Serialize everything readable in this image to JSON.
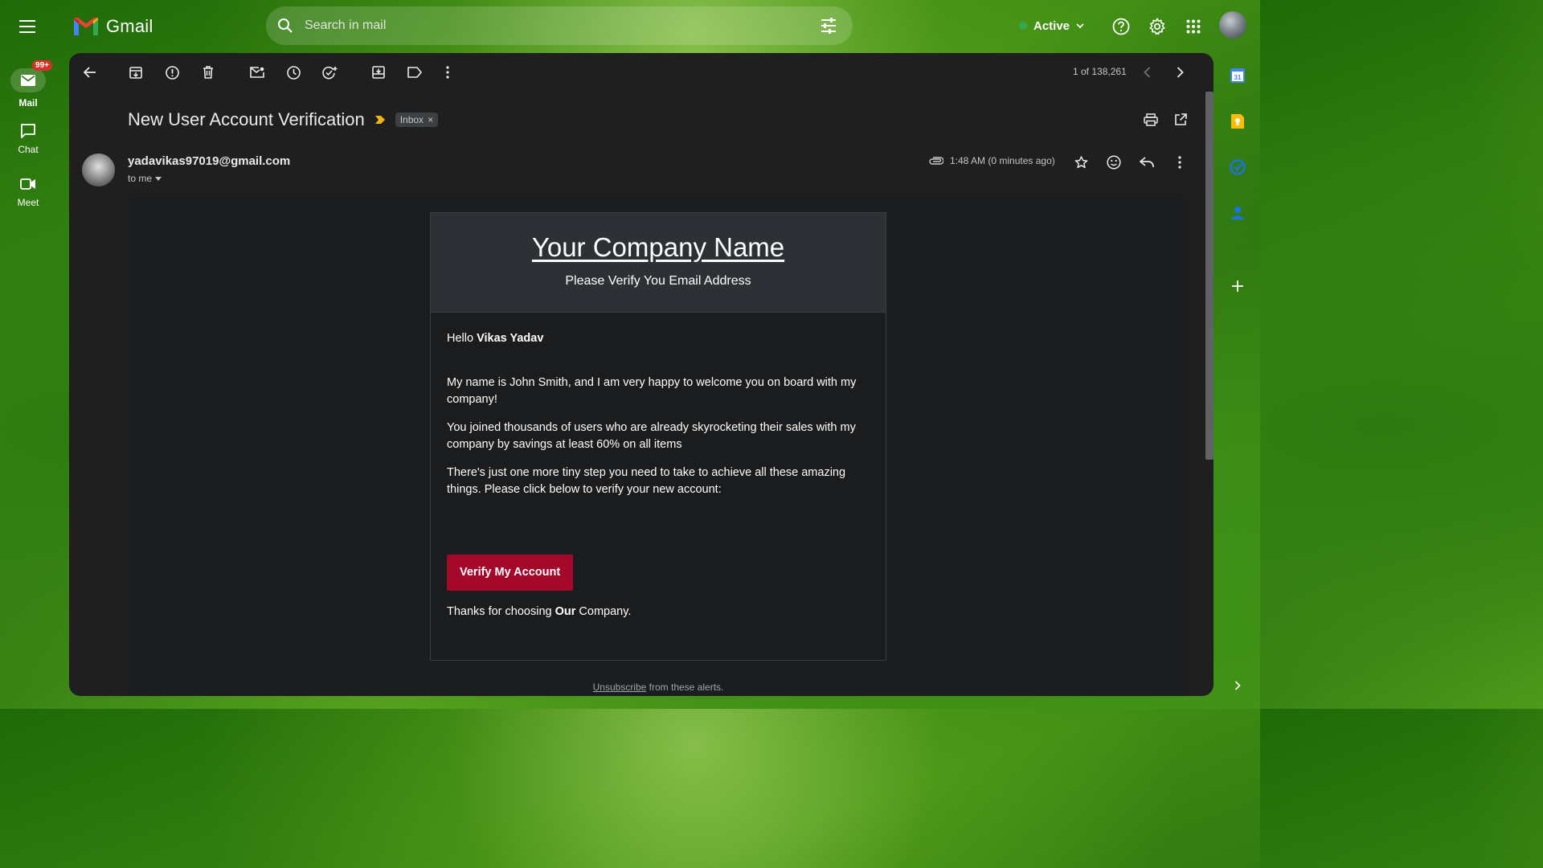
{
  "app": {
    "title": "Gmail"
  },
  "search": {
    "placeholder": "Search in mail"
  },
  "status": {
    "label": "Active"
  },
  "rail": {
    "items": [
      {
        "label": "Mail",
        "badge": "99+"
      },
      {
        "label": "Chat"
      },
      {
        "label": "Meet"
      }
    ]
  },
  "toolbar": {
    "pager": "1 of 138,261"
  },
  "email": {
    "subject": "New User Account Verification",
    "label": "Inbox",
    "sender": "yadavikas97019@gmail.com",
    "recipient": "to me",
    "time": "1:48 AM (0 minutes ago)"
  },
  "card": {
    "company": "Your Company Name",
    "subtitle": "Please Verify You Email Address",
    "hello_prefix": "Hello ",
    "hello_name": "Vikas Yadav",
    "para1": "My name is John Smith, and I am very happy to welcome you on board with my company!",
    "para2": "You joined thousands of users who are already skyrocketing their sales with my company by savings at least 60% on all items",
    "para3": "There's just one more tiny step you need to take to achieve all these amazing things. Please click below to verify your new account:",
    "button": "Verify My Account",
    "thanks_prefix": "Thanks for choosing ",
    "thanks_bold": "Our",
    "thanks_suffix": " Company."
  },
  "footer": {
    "unsubscribe": "Unsubscribe",
    "suffix": " from these alerts."
  },
  "side_panel": {
    "calendar_day": "31"
  },
  "colors": {
    "accent_red": "#a3082a",
    "status_green": "#34a853",
    "badge_red": "#d93025",
    "panel_bg": "#1f1f1f"
  }
}
